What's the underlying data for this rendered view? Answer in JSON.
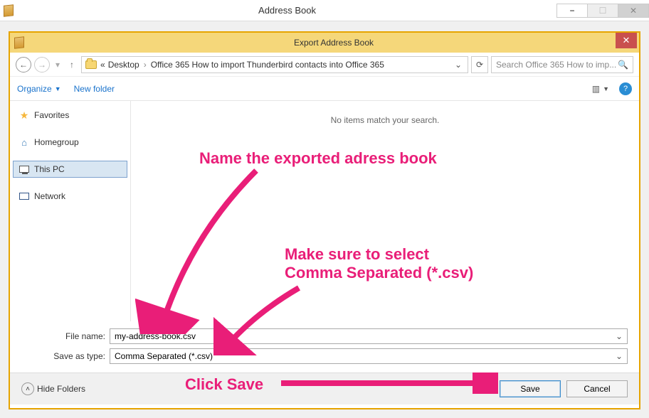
{
  "outer": {
    "title": "Address Book"
  },
  "dialog": {
    "title": "Export Address Book"
  },
  "breadcrumb": {
    "prefix": "«",
    "parts": [
      "Desktop",
      "Office 365 How to import Thunderbird contacts into Office 365"
    ]
  },
  "search": {
    "placeholder": "Search Office 365 How to imp..."
  },
  "toolbar": {
    "organize": "Organize",
    "new_folder": "New folder"
  },
  "sidebar": {
    "items": [
      {
        "label": "Favorites"
      },
      {
        "label": "Homegroup"
      },
      {
        "label": "This PC"
      },
      {
        "label": "Network"
      }
    ]
  },
  "content": {
    "empty": "No items match your search."
  },
  "form": {
    "filename_label": "File name:",
    "filename_value": "my-address-book.csv",
    "type_label": "Save as type:",
    "type_value": "Comma Separated (*.csv)"
  },
  "footer": {
    "hide_folders": "Hide Folders",
    "save": "Save",
    "cancel": "Cancel"
  },
  "annotations": {
    "title": "Name the exported adress book",
    "type": "Make sure to select\nComma Separated (*.csv)",
    "save": "Click Save"
  }
}
